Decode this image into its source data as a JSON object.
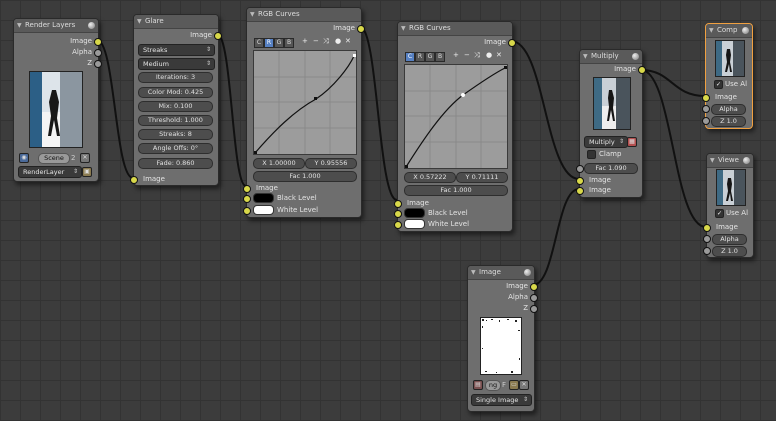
{
  "colors": {
    "canvas": "#3c3c3c",
    "node": "#6e6e6e",
    "socket_image": "#d8d84a",
    "socket_value": "#9a9a9a",
    "socket_vector": "#6f8fd0",
    "selected_outline": "#f0a040",
    "wire": "#111111"
  },
  "render_layers": {
    "title": "Render Layers",
    "outputs": [
      "Image",
      "Alpha",
      "Z"
    ],
    "scene_value": "Scene",
    "scene_count": "2",
    "layer_value": "RenderLayer"
  },
  "glare": {
    "title": "Glare",
    "type": "Streaks",
    "quality": "Medium",
    "iterations": "Iterations: 3",
    "color_mod": "Color Mod: 0.425",
    "mix": "Mix: 0.100",
    "threshold": "Threshold: 1.000",
    "streaks": "Streaks: 8",
    "angle_offset": "Angle Offs: 0°",
    "fade": "Fade: 0.860",
    "output": "Image",
    "input": "Image"
  },
  "curves1": {
    "title": "RGB Curves",
    "output": "Image",
    "channels": [
      "C",
      "R",
      "G",
      "B"
    ],
    "tools": [
      "+",
      "−",
      "⤨",
      "●",
      "✕"
    ],
    "x_value": "X 1.00000",
    "y_value": "Y 0.95556",
    "fac": "Fac 1.000",
    "inputs": [
      "Image",
      "Black Level",
      "White Level"
    ]
  },
  "curves2": {
    "title": "RGB Curves",
    "output": "Image",
    "channels": [
      "C",
      "R",
      "G",
      "B"
    ],
    "tools": [
      "+",
      "−",
      "⤨",
      "●",
      "✕"
    ],
    "x_value": "X 0.57222",
    "y_value": "Y 0.71111",
    "fac": "Fac 1.000",
    "inputs": [
      "Image",
      "Black Level",
      "White Level"
    ]
  },
  "multiply": {
    "title": "Multiply",
    "output": "Image",
    "mode": "Multiply",
    "clamp": "Clamp",
    "fac": "Fac 1.090",
    "inputs": [
      "Image",
      "Image"
    ]
  },
  "composite": {
    "title": "Comp",
    "use_alpha": "Use Al",
    "inputs": [
      "Image",
      "Alpha",
      "Z 1.0"
    ]
  },
  "viewer": {
    "title": "Viewe",
    "use_alpha": "Use Al",
    "inputs": [
      "Image",
      "Alpha",
      "Z 1.0"
    ]
  },
  "image": {
    "title": "Image",
    "outputs": [
      "Image",
      "Alpha",
      "Z"
    ],
    "file_name": "ng",
    "file_flag": "F",
    "source": "Single Image"
  }
}
